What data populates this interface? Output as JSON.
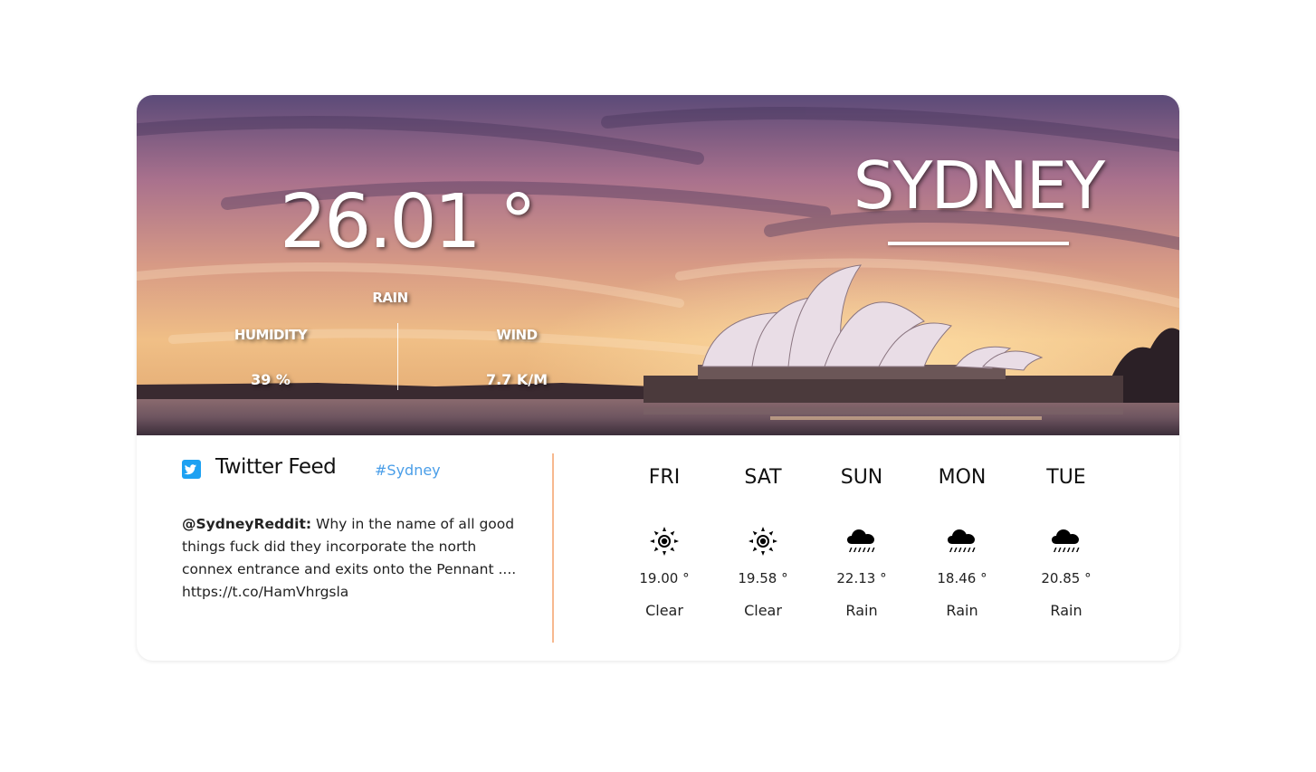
{
  "hero": {
    "temperature": "26.01 °",
    "rain_label": "RAIN",
    "humidity_label": "HUMIDITY",
    "humidity_value": "39 %",
    "wind_label": "WIND",
    "wind_value": "7.7 K/M",
    "city": "SYDNEY"
  },
  "twitter": {
    "title": "Twitter Feed",
    "hashtag": "#Sydney",
    "tweet_handle": "@SydneyReddit:",
    "tweet_text": " Why in the name of all good things fuck did they incorporate the north connex entrance and exits onto the Pennant .... https://t.co/HamVhrgsla"
  },
  "forecast": [
    {
      "day": "FRI",
      "temp": "19.00 °",
      "condition": "Clear",
      "icon": "sun-icon"
    },
    {
      "day": "SAT",
      "temp": "19.58 °",
      "condition": "Clear",
      "icon": "sun-icon"
    },
    {
      "day": "SUN",
      "temp": "22.13 °",
      "condition": "Rain",
      "icon": "rain-cloud-icon"
    },
    {
      "day": "MON",
      "temp": "18.46 °",
      "condition": "Rain",
      "icon": "rain-cloud-icon"
    },
    {
      "day": "TUE",
      "temp": "20.85 °",
      "condition": "Rain",
      "icon": "rain-cloud-icon"
    }
  ],
  "colors": {
    "accent_divider": "#f7b98f",
    "hashtag": "#4a9ee8",
    "twitter_blue": "#1da1f2"
  }
}
